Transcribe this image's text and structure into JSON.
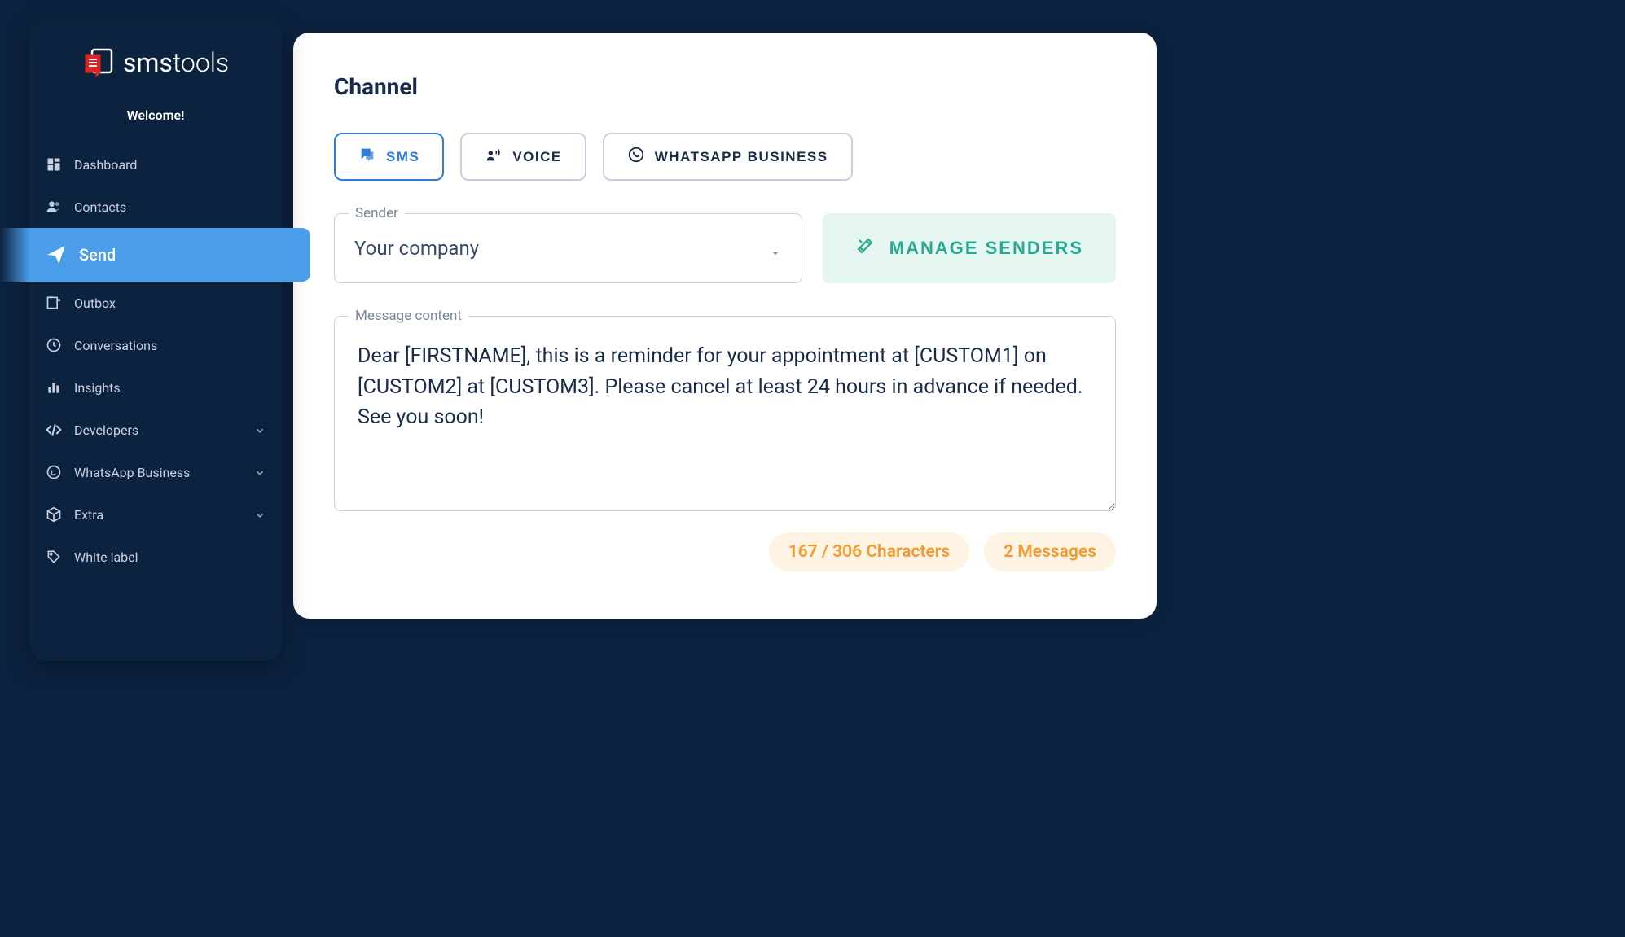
{
  "logo": {
    "brand1": "sms",
    "brand2": "tools"
  },
  "sidebar": {
    "welcome": "Welcome!",
    "items": [
      {
        "label": "Dashboard",
        "icon": "dashboard"
      },
      {
        "label": "Contacts",
        "icon": "contacts"
      },
      {
        "label": "Send",
        "icon": "send",
        "active": true
      },
      {
        "label": "Outbox",
        "icon": "outbox"
      },
      {
        "label": "Conversations",
        "icon": "conversations"
      },
      {
        "label": "Insights",
        "icon": "insights"
      },
      {
        "label": "Developers",
        "icon": "code",
        "expandable": true
      },
      {
        "label": "WhatsApp Business",
        "icon": "whatsapp",
        "expandable": true
      },
      {
        "label": "Extra",
        "icon": "box",
        "expandable": true
      },
      {
        "label": "White label",
        "icon": "whitelabel"
      }
    ]
  },
  "main": {
    "title": "Channel",
    "tabs": [
      {
        "label": "SMS",
        "active": true
      },
      {
        "label": "VOICE"
      },
      {
        "label": "WHATSAPP BUSINESS"
      }
    ],
    "sender": {
      "label": "Sender",
      "value": "Your company",
      "manage": "MANAGE SENDERS"
    },
    "message": {
      "label": "Message content",
      "value": "Dear [FIRSTNAME], this is a reminder for your appointment at [CUSTOM1] on [CUSTOM2] at [CUSTOM3]. Please cancel at least 24 hours in advance if needed. See you soon!"
    },
    "counters": {
      "chars": "167 / 306 Characters",
      "messages": "2 Messages"
    }
  }
}
